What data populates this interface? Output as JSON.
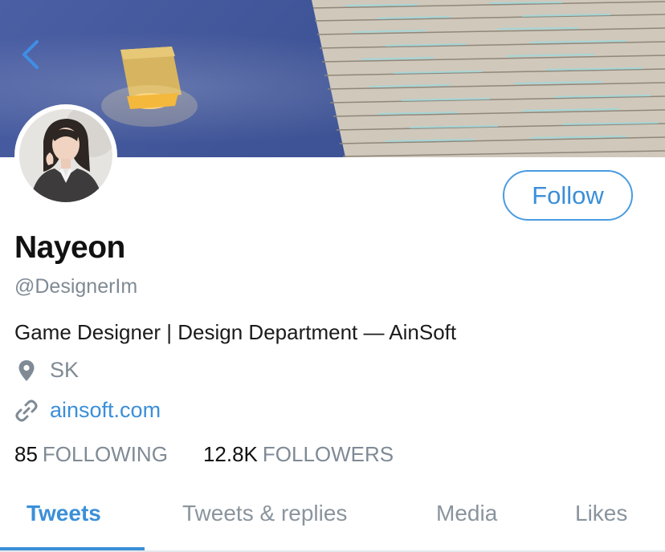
{
  "header": {
    "back_icon": "chevron-left-icon"
  },
  "profile": {
    "display_name": "Nayeon",
    "handle": "@DesignerIm",
    "bio": "Game Designer | Design Department — AinSoft",
    "location": "SK",
    "website": "ainsoft.com",
    "follow_label": "Follow"
  },
  "stats": {
    "following_count": "85",
    "following_label": "FOLLOWING",
    "followers_count": "12.8K",
    "followers_label": "FOLLOWERS"
  },
  "tabs": [
    {
      "label": "Tweets",
      "active": true
    },
    {
      "label": "Tweets & replies"
    },
    {
      "label": "Media"
    },
    {
      "label": "Likes"
    }
  ],
  "colors": {
    "accent": "#3b8fd8",
    "muted": "#7f8a95",
    "banner": "#4b5fa4"
  }
}
